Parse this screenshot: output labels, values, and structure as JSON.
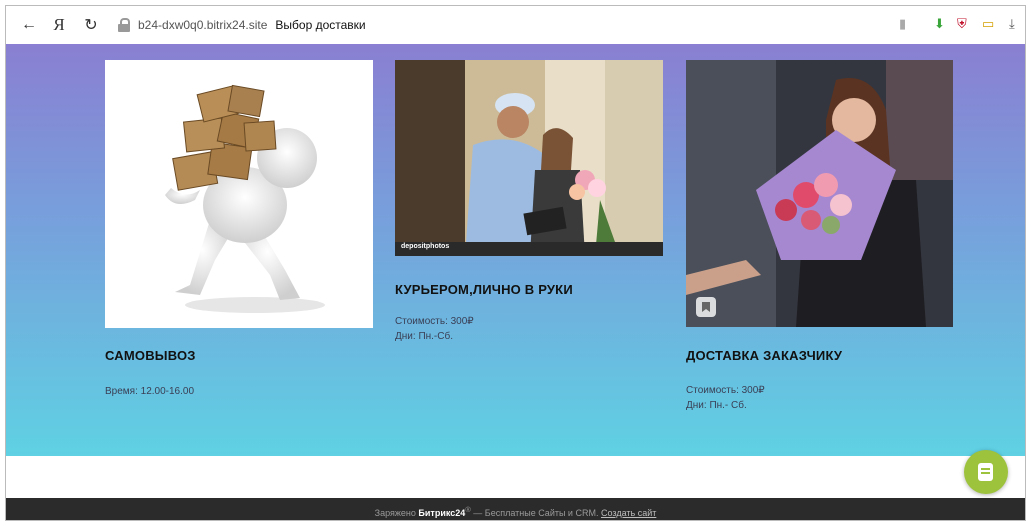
{
  "browser": {
    "url": "b24-dxw0q0.bitrix24.site",
    "page_title": "Выбор доставки",
    "logo_glyph": "Я"
  },
  "cards": [
    {
      "title": "САМОВЫВОЗ",
      "line1": "Время: 12.00-16.00",
      "line2": ""
    },
    {
      "title": "КУРЬЕРОМ,ЛИЧНО В РУКИ",
      "line1": "Стоимость: 300₽",
      "line2": "Дни: Пн.-Сб.",
      "watermark": "depositphotos"
    },
    {
      "title": "ДОСТАВКА ЗАКАЗЧИКУ",
      "line1": "Стоимость: 300₽",
      "line2": "Дни: Пн.- Сб."
    }
  ],
  "footer": {
    "prefix": "Заряжено",
    "brand": "Битрикс24",
    "middle": "— Бесплатные Сайты и CRM.",
    "link": "Создать сайт"
  },
  "colors": {
    "gradient_top": "#8a7fd2",
    "gradient_bottom": "#5fd1e3",
    "fab": "#9dc23c",
    "footer_bg": "#2b2b2b"
  }
}
